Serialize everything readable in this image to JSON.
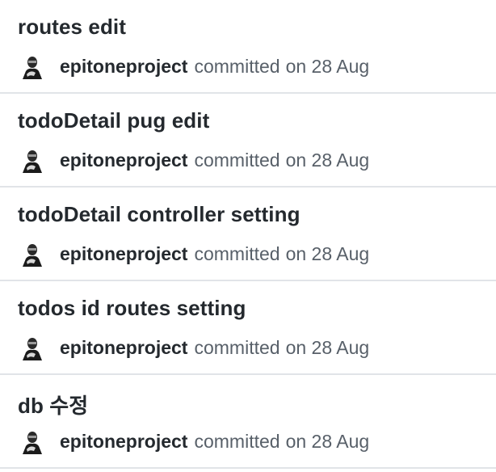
{
  "commits": [
    {
      "title": "routes edit",
      "author": "epitoneproject",
      "action": "committed",
      "date": "on 28 Aug"
    },
    {
      "title": "todoDetail pug edit",
      "author": "epitoneproject",
      "action": "committed",
      "date": "on 28 Aug"
    },
    {
      "title": "todoDetail controller setting",
      "author": "epitoneproject",
      "action": "committed",
      "date": "on 28 Aug"
    },
    {
      "title": "todos id routes setting",
      "author": "epitoneproject",
      "action": "committed",
      "date": "on 28 Aug"
    },
    {
      "title": "db 수정",
      "author": "epitoneproject",
      "action": "committed",
      "date": "on 28 Aug"
    }
  ],
  "colors": {
    "title": "#24292e",
    "muted": "#586069",
    "divider": "#e1e4e8"
  },
  "icons": {
    "avatar": "user-avatar-icon"
  }
}
